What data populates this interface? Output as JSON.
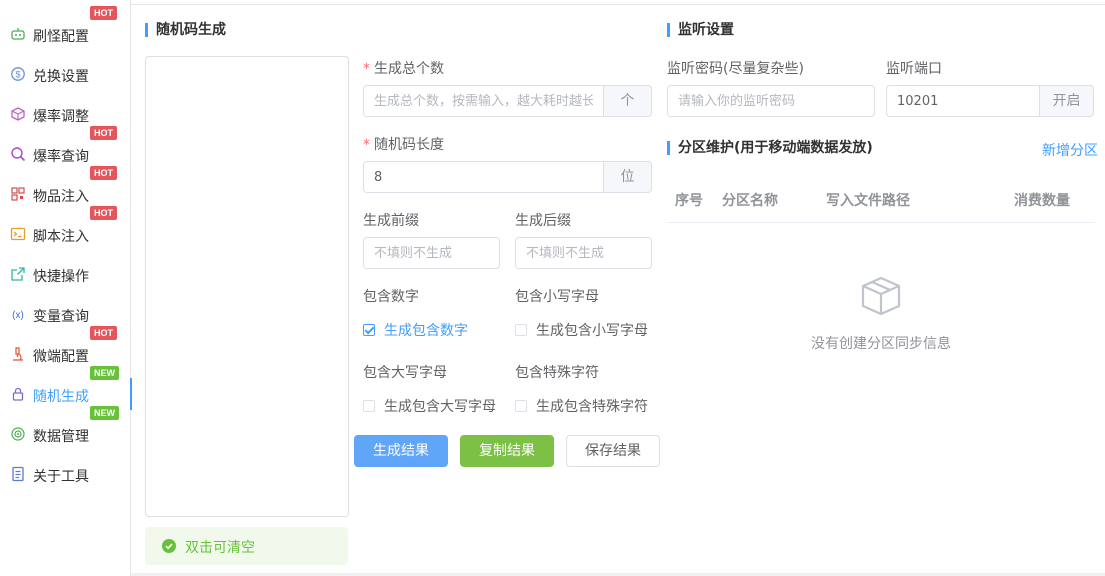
{
  "sidebar": {
    "items": [
      {
        "label": "刷怪配置",
        "icon": "robot-icon",
        "badge": "HOT"
      },
      {
        "label": "兑换设置",
        "icon": "coin-icon",
        "badge": ""
      },
      {
        "label": "爆率调整",
        "icon": "box-icon",
        "badge": ""
      },
      {
        "label": "爆率查询",
        "icon": "search-icon",
        "badge": "HOT"
      },
      {
        "label": "物品注入",
        "icon": "qrcode-icon",
        "badge": "HOT"
      },
      {
        "label": "脚本注入",
        "icon": "terminal-icon",
        "badge": "HOT"
      },
      {
        "label": "快捷操作",
        "icon": "external-link-icon",
        "badge": ""
      },
      {
        "label": "变量查询",
        "icon": "variable-icon",
        "badge": ""
      },
      {
        "label": "微端配置",
        "icon": "microscope-icon",
        "badge": "HOT"
      },
      {
        "label": "随机生成",
        "icon": "lock-icon",
        "badge": "NEW"
      },
      {
        "label": "数据管理",
        "icon": "target-icon",
        "badge": "NEW"
      },
      {
        "label": "关于工具",
        "icon": "document-icon",
        "badge": ""
      }
    ],
    "active_index": 9
  },
  "random": {
    "title": "随机码生成",
    "result_tip": "双击可清空",
    "total_label": "生成总个数",
    "total_placeholder": "生成总个数，按需输入，越大耗时越长",
    "total_unit": "个",
    "length_label": "随机码长度",
    "length_value": "8",
    "length_unit": "位",
    "prefix_label": "生成前缀",
    "prefix_placeholder": "不填则不生成",
    "suffix_label": "生成后缀",
    "suffix_placeholder": "不填则不生成",
    "opt_digits_label": "包含数字",
    "opt_digits_cb": "生成包含数字",
    "opt_lower_label": "包含小写字母",
    "opt_lower_cb": "生成包含小写字母",
    "opt_upper_label": "包含大写字母",
    "opt_upper_cb": "生成包含大写字母",
    "opt_special_label": "包含特殊字符",
    "opt_special_cb": "生成包含特殊字符",
    "options_checked": {
      "digits": true,
      "lower": false,
      "upper": false,
      "special": false
    },
    "btn_generate": "生成结果",
    "btn_copy": "复制结果",
    "btn_save": "保存结果"
  },
  "listen": {
    "title": "监听设置",
    "password_label": "监听密码(尽量复杂些)",
    "password_placeholder": "请输入你的监听密码",
    "port_label": "监听端口",
    "port_value": "10201",
    "port_button": "开启"
  },
  "partition": {
    "title": "分区维护(用于移动端数据发放)",
    "add_link": "新增分区",
    "columns": [
      "序号",
      "分区名称",
      "写入文件路径",
      "消费数量"
    ],
    "empty_text": "没有创建分区同步信息"
  },
  "colors": {
    "accent": "#409eff",
    "hot": "#e5565c",
    "new": "#67c23a",
    "success": "#7cc146"
  }
}
